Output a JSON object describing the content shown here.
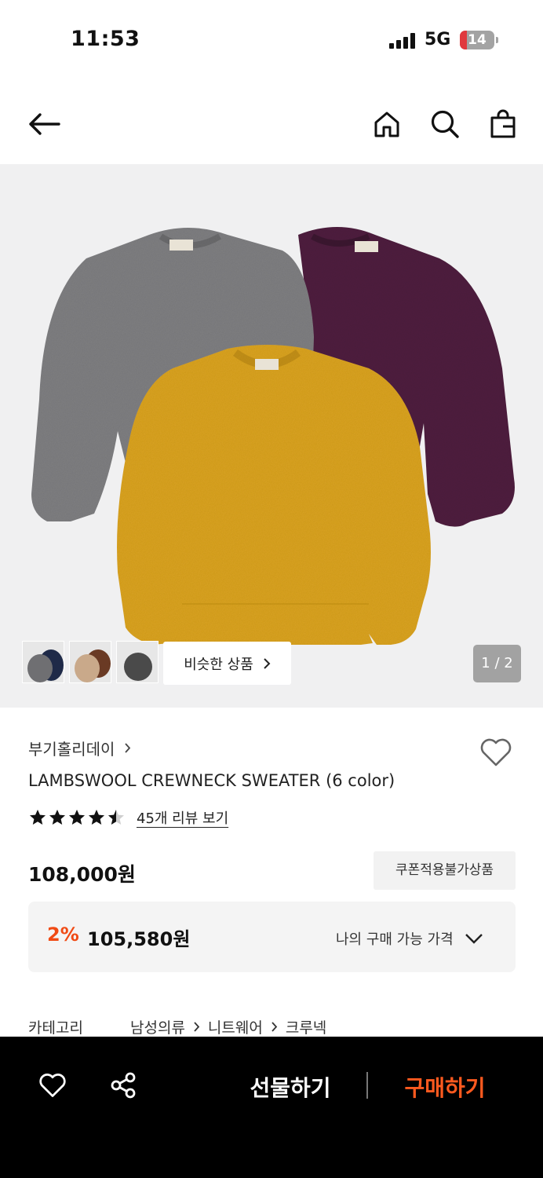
{
  "status_bar": {
    "time": "11:53",
    "network": "5G",
    "battery": "14"
  },
  "nav": {
    "icons": [
      "back-arrow-icon",
      "home-icon",
      "search-icon",
      "shopping-bag-icon"
    ]
  },
  "gallery": {
    "similar_label": "비슷한 상품",
    "page_indicator": "1 / 2",
    "thumbnails": [
      "thumb-gray-navy-sweaters",
      "thumb-beige-brown-sweaters",
      "thumb-charcoal-sweater"
    ]
  },
  "product": {
    "brand": "부기홀리데이",
    "name": "LAMBSWOOL CREWNECK SWEATER (6 color)",
    "rating": 4.5,
    "review_link": "45개 리뷰 보기",
    "price": "108,000원",
    "coupon_badge": "쿠폰적용불가상품",
    "discount_rate": "2%",
    "discount_price": "105,580원",
    "my_price_label": "나의 구매 가능 가격",
    "category_label": "카테고리",
    "category_path": [
      "남성의류",
      "니트웨어",
      "크루넥"
    ]
  },
  "bottom_bar": {
    "gift_label": "선물하기",
    "buy_label": "구매하기"
  },
  "colors": {
    "accent": "#f04a14",
    "buy": "#ff5a1f",
    "bar_bg": "#000000"
  }
}
